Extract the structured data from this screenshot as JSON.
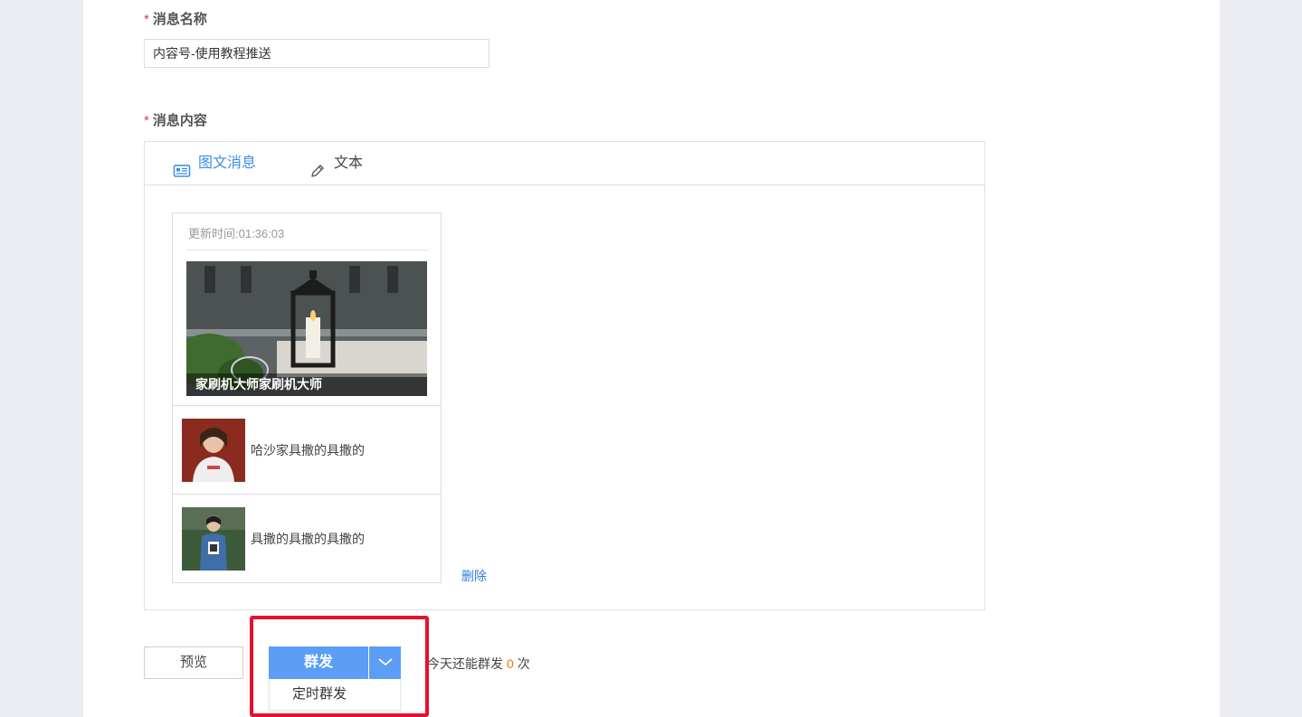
{
  "form": {
    "name_label": "消息名称",
    "name_value": "内容号-使用教程推送",
    "content_label": "消息内容",
    "required_mark": "*"
  },
  "tabs": [
    {
      "label": "图文消息",
      "icon": "news-card-icon",
      "active": true
    },
    {
      "label": "文本",
      "icon": "pencil-icon",
      "active": false
    }
  ],
  "article": {
    "update_time": "更新时间:01:36:03",
    "cover_title": "家刷机大师家刷机大师",
    "items": [
      {
        "title": "哈沙家具撒的具撒的"
      },
      {
        "title": "具撒的具撒的具撒的"
      }
    ],
    "delete_label": "删除"
  },
  "actions": {
    "preview_label": "预览",
    "send_label": "群发",
    "scheduled_label": "定时群发",
    "quota_prefix": "今天还能群发",
    "quota_count": "0",
    "quota_suffix": "次"
  },
  "colors": {
    "accent": "#3a8ee6",
    "button": "#5c9ef5",
    "required": "#e8364b",
    "count": "#ff6a00",
    "highlight": "#e5112f"
  }
}
